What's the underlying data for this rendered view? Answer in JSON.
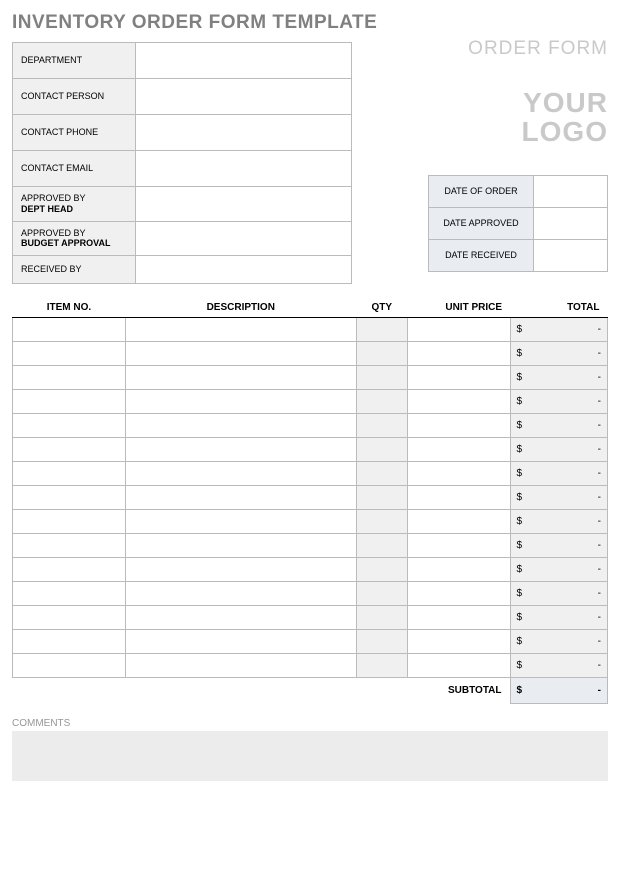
{
  "title": "INVENTORY ORDER FORM TEMPLATE",
  "orderFormLabel": "ORDER FORM",
  "logoLine1": "YOUR",
  "logoLine2": "LOGO",
  "info": {
    "rows": [
      {
        "label": "DEPARTMENT",
        "sub": "",
        "value": "",
        "short": false
      },
      {
        "label": "CONTACT PERSON",
        "sub": "",
        "value": "",
        "short": false
      },
      {
        "label": "CONTACT PHONE",
        "sub": "",
        "value": "",
        "short": false
      },
      {
        "label": "CONTACT EMAIL",
        "sub": "",
        "value": "",
        "short": false
      },
      {
        "label": "APPROVED BY",
        "sub": "DEPT HEAD",
        "value": "",
        "short": true
      },
      {
        "label": "APPROVED BY",
        "sub": "BUDGET APPROVAL",
        "value": "",
        "short": true
      },
      {
        "label": "RECEIVED BY",
        "sub": "",
        "value": "",
        "short": true
      }
    ]
  },
  "dates": {
    "rows": [
      {
        "label": "DATE OF ORDER",
        "value": ""
      },
      {
        "label": "DATE APPROVED",
        "value": ""
      },
      {
        "label": "DATE RECEIVED",
        "value": ""
      }
    ]
  },
  "items": {
    "headers": {
      "itemNo": "ITEM NO.",
      "description": "DESCRIPTION",
      "qty": "QTY",
      "unitPrice": "UNIT PRICE",
      "total": "TOTAL"
    },
    "currency": "$",
    "dash": "-",
    "rowCount": 15
  },
  "subtotal": {
    "label": "SUBTOTAL",
    "currency": "$",
    "value": "-"
  },
  "commentsLabel": "COMMENTS"
}
